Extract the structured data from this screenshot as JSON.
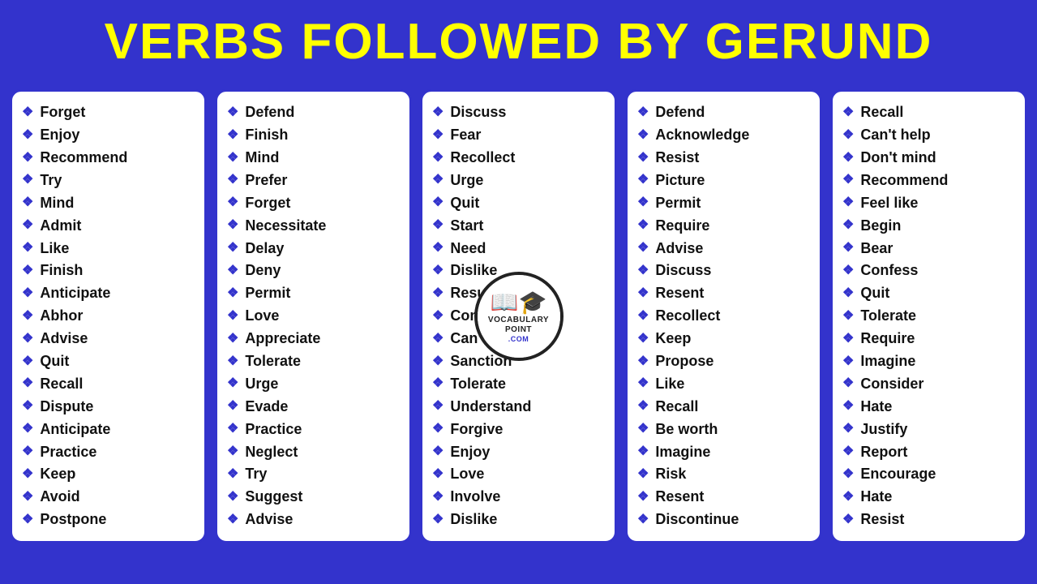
{
  "header": {
    "title": "VERBS FOLLOWED BY GERUND"
  },
  "columns": [
    {
      "id": "col1",
      "words": [
        "Forget",
        "Enjoy",
        "Recommend",
        "Try",
        "Mind",
        "Admit",
        "Like",
        "Finish",
        "Anticipate",
        "Abhor",
        "Advise",
        "Quit",
        "Recall",
        "Dispute",
        "Anticipate",
        "Practice",
        "Keep",
        "Avoid",
        "Postpone"
      ]
    },
    {
      "id": "col2",
      "words": [
        "Defend",
        "Finish",
        "Mind",
        "Prefer",
        "Forget",
        "Necessitate",
        "Delay",
        "Deny",
        "Permit",
        "Love",
        "Appreciate",
        "Tolerate",
        "Urge",
        "Evade",
        "Practice",
        "Neglect",
        "Try",
        "Suggest",
        "Advise"
      ]
    },
    {
      "id": "col3",
      "hasLogo": true,
      "words": [
        "Discuss",
        "Fear",
        "Recollect",
        "Urge",
        "Quit",
        "Start",
        "Need",
        "Dislike",
        "Resume",
        "Complete",
        "Can't help",
        "Sanction",
        "Tolerate",
        "Understand",
        "Forgive",
        "Enjoy",
        "Love",
        "Involve",
        "Dislike"
      ]
    },
    {
      "id": "col4",
      "words": [
        "Defend",
        "Acknowledge",
        "Resist",
        "Picture",
        "Permit",
        "Require",
        "Advise",
        "Discuss",
        "Resent",
        "Recollect",
        "Keep",
        "Propose",
        "Like",
        "Recall",
        "Be worth",
        "Imagine",
        "Risk",
        "Resent",
        "Discontinue"
      ]
    },
    {
      "id": "col5",
      "words": [
        "Recall",
        "Can't help",
        "Don't mind",
        "Recommend",
        "Feel like",
        "Begin",
        "Bear",
        "Confess",
        "Quit",
        "Tolerate",
        "Require",
        "Imagine",
        "Consider",
        "Hate",
        "Justify",
        "Report",
        "Encourage",
        "Hate",
        "Resist"
      ]
    }
  ],
  "logo": {
    "icon": "📖",
    "line1": "VOCABULARY",
    "line2": "POINT",
    "line3": ".COM"
  },
  "diamond": "❖"
}
